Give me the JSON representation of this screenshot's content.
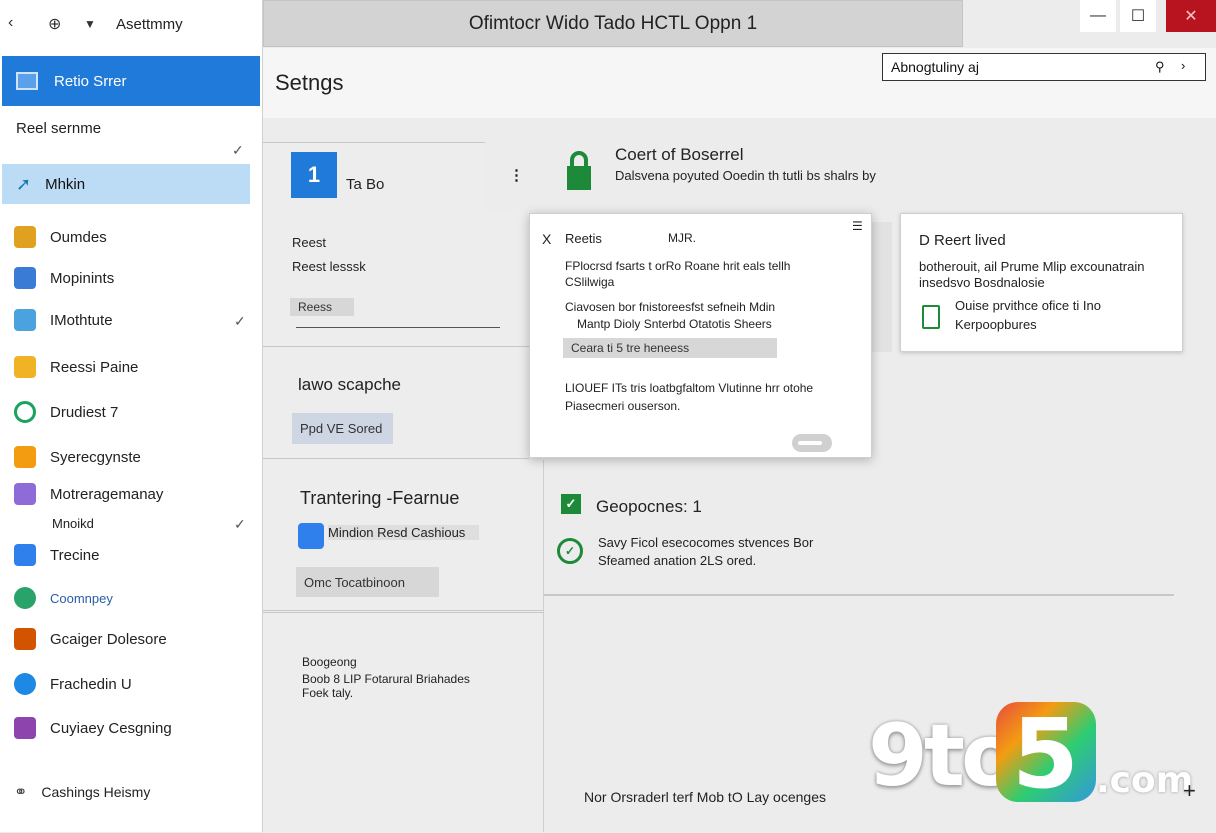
{
  "sidebar": {
    "account": "Asettmmy",
    "selected": "Retio Srrer",
    "section_label": "Reel sernme",
    "highlight": "Mhkin",
    "items": [
      {
        "label": "Oumdes",
        "color": "#e0a020"
      },
      {
        "label": "Mopinints",
        "color": "#3a7bd5"
      },
      {
        "label": "IMothtute",
        "color": "#4aa3df"
      },
      {
        "label": "Reessi Paine",
        "color": "#f0b323"
      },
      {
        "label": "Drudiest 7",
        "color": "#1aa260"
      },
      {
        "label": "Syerecgynste",
        "color": "#f39c12"
      },
      {
        "label": "Motreragemanay",
        "color": "#8e6bd8"
      },
      {
        "label": "Trecine",
        "color": "#2f80ed"
      },
      {
        "label": "Coomnpey",
        "color": "#29a36a"
      },
      {
        "label": "Gcaiger Dolesore",
        "color": "#d35400"
      },
      {
        "label": "Frachedin U",
        "color": "#1e88e5"
      },
      {
        "label": "Cuyiaey Cesgning",
        "color": "#8e44ad"
      }
    ],
    "sub_label": "Mnoikd",
    "footer": "Cashings Heismy"
  },
  "titlebar": {
    "title": "Ofimtocr Wido Tado HCTL Oppn 1"
  },
  "header": {
    "title": "Setngs"
  },
  "search": {
    "value": "Abnogtuliny aj"
  },
  "left": {
    "tile_number": "1",
    "tile_label": "Ta Bo",
    "lines": [
      "Reest",
      "Reest lesssk",
      "Reess"
    ],
    "section2_title": "lawo scapche",
    "section2_button": "Ppd VE Sored",
    "section3_title": "Trantering -Fearnue",
    "section3_item": "Mindion Resd Cashious",
    "section3_button": "Omc Tocatbinoon",
    "section4_lines": [
      "Boogeong",
      "Boob 8 LIP Fotarural Briahades",
      "Foek taly."
    ]
  },
  "right": {
    "title": "Coert of Boserrel",
    "subtitle": "Dalsvena poyuted Ooedin th tutli bs shalrs by",
    "card2_title": "D Reert lived",
    "card2_line1": "botherouit, ail Prume Mlip excounatrain",
    "card2_line2": "insedsvo Bosdnalosie",
    "card2_line3": "Ouise prvithce ofice ti Ino",
    "card2_line4": "Kerpoopbures",
    "section_title": "Geopocnes: 1",
    "section_line1": "Savy Ficol esecocomes stvences Bor",
    "section_line2": "Sfeamed anation 2LS ored.",
    "footer_text": "Nor Orsraderl terf Mob tO Lay ocenges"
  },
  "dialog": {
    "close_label": "X",
    "title": "Reetis",
    "tag": "MJR.",
    "line1": "FPlocrsd fsarts t orRo Roane hrit eals tellh",
    "line2": "CSlilwiga",
    "line3": "Ciavosen bor fnistoreesfst sefneih Mdin",
    "line4": "Mantp Dioly Snterbd Otatotis Sheers",
    "pill": "Ceara ti 5 tre heneess",
    "line5": "LIOUEF ITs tris loatbgfaltom Vlutinne hrr otohe",
    "line6": "Piasecmeri ouserson."
  },
  "watermark": {
    "nine": "9to",
    "five": "5",
    "com": ".com"
  },
  "colors": {
    "accent": "#1f7ad9",
    "highlight": "#bcdcf6",
    "green": "#1d8a3a",
    "close": "#b8141f"
  }
}
